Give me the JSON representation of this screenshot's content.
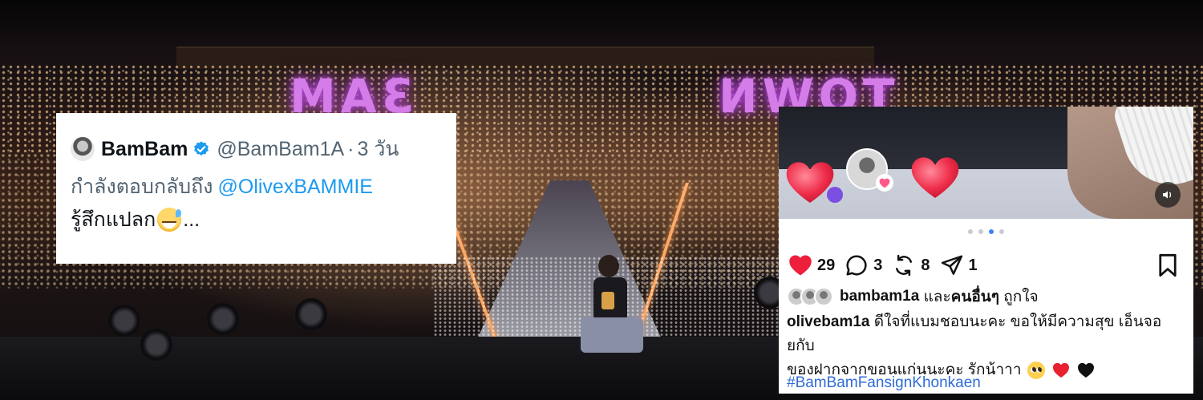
{
  "background": {
    "banner_left": "3AM",
    "banner_right": "TOWN"
  },
  "tweet": {
    "display_name": "BamBam",
    "handle": "@BamBam1A",
    "separator": "·",
    "time": "3 วัน",
    "reply_prefix": "กำลังตอบกลับถึง",
    "reply_target": "@OlivexBAMMIE",
    "body_text": "รู้สึกแปลก",
    "body_suffix": "...",
    "verified_color": "#1d9bf0",
    "avatar_icon": "avatar"
  },
  "post": {
    "carousel": {
      "count": 4,
      "active_index": 2
    },
    "actions": {
      "likes": "29",
      "comments": "3",
      "reposts": "8",
      "shares": "1"
    },
    "liked_by": {
      "user": "bambam1a",
      "and_text": "และ",
      "others": "คนอื่นๆ",
      "suffix": "ถูกใจ"
    },
    "caption": {
      "author": "olivebam1a",
      "text_line1": "ดีใจที่แบมชอบนะคะ ขอให้มีความสุข เอ็นจอยกับ",
      "text_line2": "ของฝากจากขอนแก่นนะคะ รักน้าาา"
    },
    "hashtag": "#BamBamFansignKhonkaen",
    "like_color": "#ed1f3c",
    "hashtag_color": "#2f6bd6"
  }
}
